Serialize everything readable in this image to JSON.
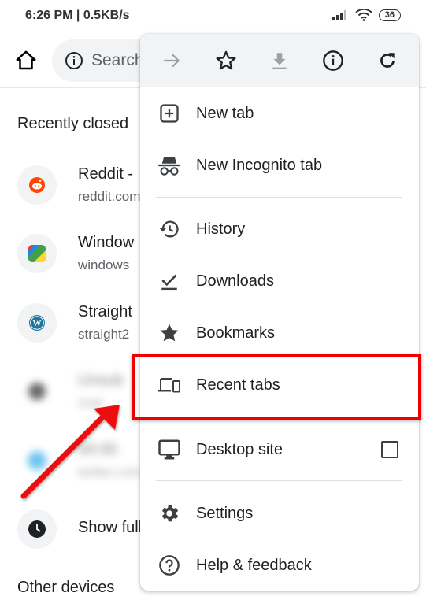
{
  "status_bar": {
    "time": "6:26 PM | 0.5KB/s",
    "battery": "36",
    "icons": [
      "signal-icon",
      "wifi-icon",
      "battery-icon"
    ]
  },
  "toolbar": {
    "home_icon": "home-icon",
    "omnibox_placeholder": "Search",
    "omnibox_icon": "info-icon"
  },
  "background": {
    "recently_closed_title": "Recently closed",
    "tabs": [
      {
        "title": "Reddit -",
        "url": "reddit.com",
        "favicon": "reddit-icon",
        "color": "#ff4500",
        "blurred": false
      },
      {
        "title": "Window",
        "url": "windows",
        "favicon": "windows-app-icon",
        "color": "#34a853",
        "blurred": false
      },
      {
        "title": "Straight",
        "url": "straight2",
        "favicon": "wordpress-icon",
        "color": "#21759b",
        "blurred": false
      },
      {
        "title": "Unsub",
        "url": "mail",
        "favicon": "generic-icon",
        "color": "#666666",
        "blurred": true
      },
      {
        "title": "00:00",
        "url": "twitter.com",
        "favicon": "twitter-icon",
        "color": "#6fc3f0",
        "blurred": true
      }
    ],
    "show_full_history": "Show full history",
    "other_devices_title": "Other devices"
  },
  "menu": {
    "icon_bar": [
      {
        "name": "forward-icon",
        "label": "Forward",
        "enabled": false
      },
      {
        "name": "bookmark-star-icon",
        "label": "Bookmark",
        "enabled": true
      },
      {
        "name": "download-icon",
        "label": "Download",
        "enabled": false
      },
      {
        "name": "page-info-icon",
        "label": "Page info",
        "enabled": true
      },
      {
        "name": "reload-icon",
        "label": "Reload",
        "enabled": true
      }
    ],
    "items": [
      {
        "label": "New tab",
        "icon": "new-tab-icon"
      },
      {
        "label": "New Incognito tab",
        "icon": "incognito-icon"
      },
      {
        "label": "History",
        "icon": "history-icon"
      },
      {
        "label": "Downloads",
        "icon": "downloads-icon"
      },
      {
        "label": "Bookmarks",
        "icon": "bookmarks-icon"
      },
      {
        "label": "Recent tabs",
        "icon": "recent-tabs-icon"
      },
      {
        "label": "Desktop site",
        "icon": "desktop-icon",
        "checked": false
      },
      {
        "label": "Settings",
        "icon": "settings-icon"
      },
      {
        "label": "Help & feedback",
        "icon": "help-icon"
      }
    ]
  },
  "annotation": {
    "highlighted_item": "Recent tabs",
    "color": "#ee0000"
  }
}
